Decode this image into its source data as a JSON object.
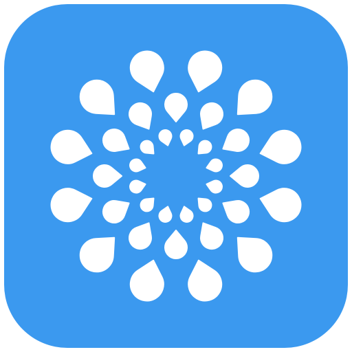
{
  "icon": {
    "name": "burst-petals-icon",
    "background_color": "#3B99EF",
    "glyph_color": "#FFFFFF"
  }
}
